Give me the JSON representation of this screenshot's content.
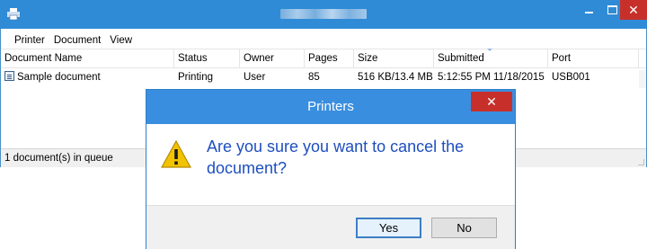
{
  "window": {
    "title": "",
    "minimize": "",
    "close": "✕"
  },
  "menu": [
    "Printer",
    "Document",
    "View"
  ],
  "columns": [
    "Document Name",
    "Status",
    "Owner",
    "Pages",
    "Size",
    "Submitted",
    "Port"
  ],
  "rows": [
    {
      "name": "Sample document",
      "status": "Printing",
      "owner": "User",
      "pages": "85",
      "size": "516 KB/13.4 MB",
      "submitted": "5:12:55 PM  11/18/2015",
      "port": "USB001"
    }
  ],
  "statusbar": "1 document(s) in queue",
  "dialog": {
    "title": "Printers",
    "close": "✕",
    "message": "Are you sure you want to cancel the document?",
    "yes": "Yes",
    "no": "No"
  },
  "colors": {
    "titlebar": "#2f8bd6",
    "close": "#c7302a",
    "message": "#1e4fbf"
  }
}
